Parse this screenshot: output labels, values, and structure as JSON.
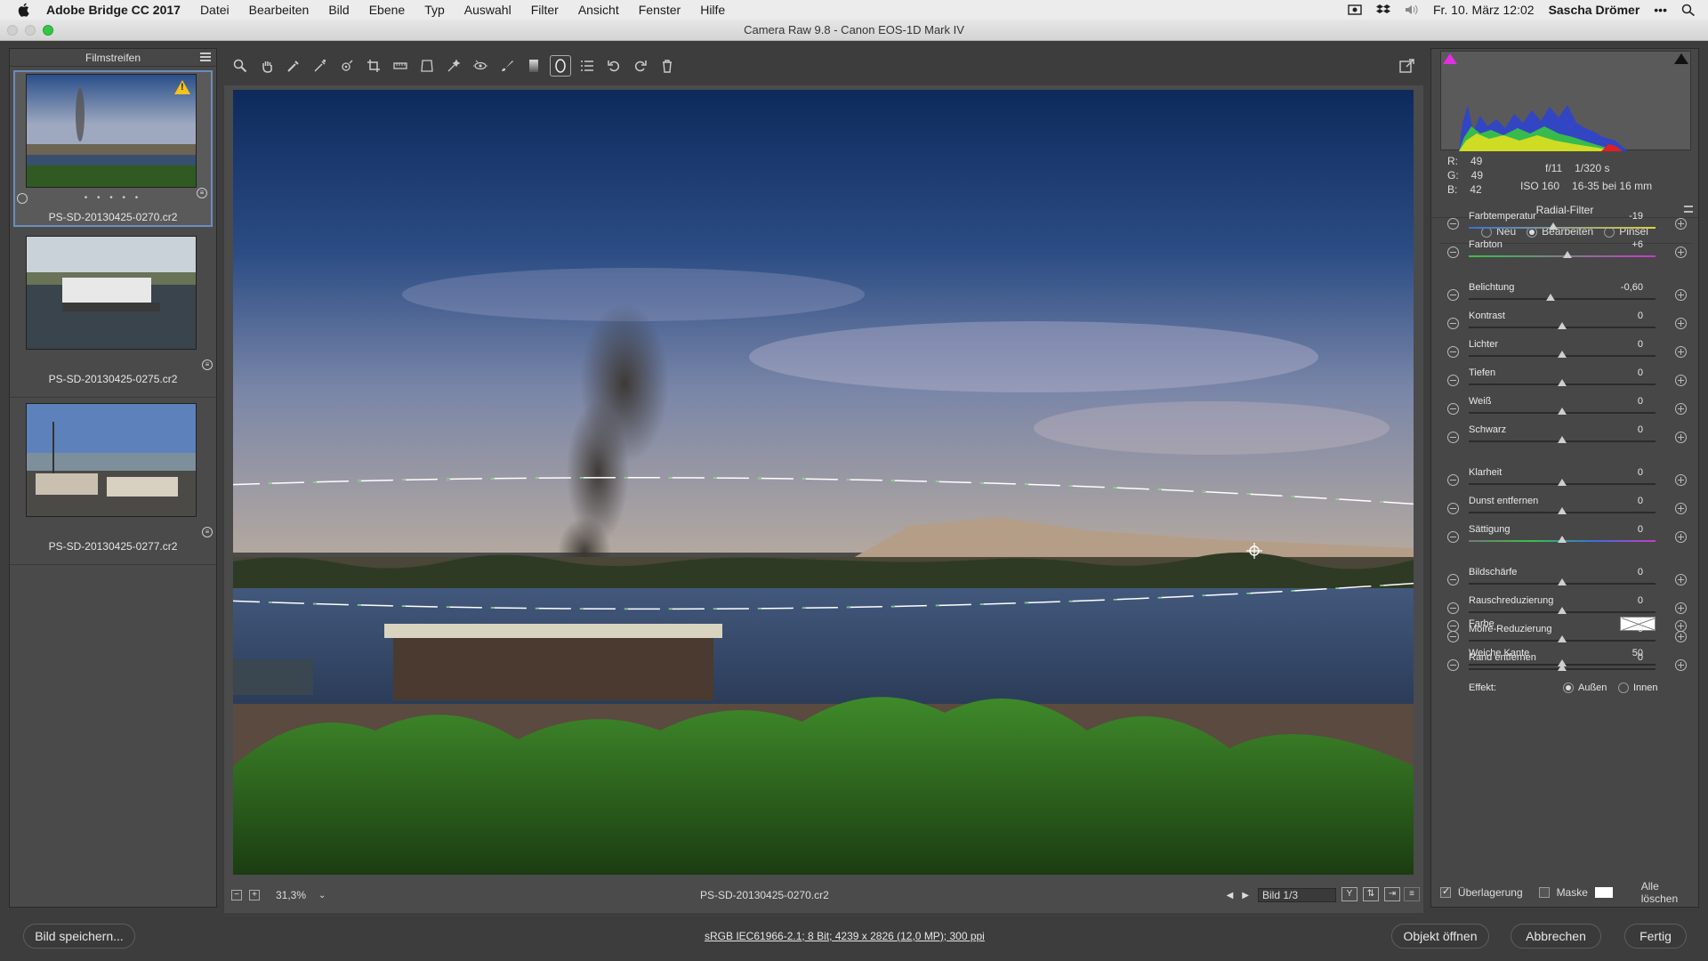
{
  "menubar": {
    "app_name": "Adobe Bridge CC 2017",
    "items": [
      "Datei",
      "Bearbeiten",
      "Bild",
      "Ebene",
      "Typ",
      "Auswahl",
      "Filter",
      "Ansicht",
      "Fenster",
      "Hilfe"
    ],
    "datetime": "Fr. 10. März 12:02",
    "user": "Sascha Drömer",
    "more": "•••"
  },
  "window": {
    "title": "Camera Raw 9.8 - Canon EOS-1D Mark IV"
  },
  "filmstrip": {
    "title": "Filmstreifen",
    "items": [
      {
        "name": "PS-SD-20130425-0270.cr2",
        "rating": "• • • • •"
      },
      {
        "name": "PS-SD-20130425-0275.cr2"
      },
      {
        "name": "PS-SD-20130425-0277.cr2"
      }
    ]
  },
  "status": {
    "zoom": "31,3%",
    "zoom_dropdown": "⌄",
    "filename": "PS-SD-20130425-0270.cr2",
    "image_counter": "Bild 1/3"
  },
  "histogram": {
    "r_label": "R:",
    "r": "49",
    "g_label": "G:",
    "g": "49",
    "b_label": "B:",
    "b": "42",
    "aperture": "f/11",
    "shutter": "1/320 s",
    "iso": "ISO 160",
    "lens": "16-35 bei 16 mm"
  },
  "panel": {
    "title": "Radial-Filter",
    "modes": [
      {
        "label": "Neu",
        "selected": false
      },
      {
        "label": "Bearbeiten",
        "selected": true
      },
      {
        "label": "Pinsel",
        "selected": false
      }
    ],
    "sliders": [
      {
        "label": "Farbtemperatur",
        "value": "-19",
        "pos": 0.45,
        "track": "temp"
      },
      {
        "label": "Farbton",
        "value": "+6",
        "pos": 0.53,
        "track": "tint"
      },
      {
        "label": "Belichtung",
        "value": "-0,60",
        "pos": 0.44,
        "track": "plain"
      },
      {
        "label": "Kontrast",
        "value": "0",
        "pos": 0.5,
        "track": "plain"
      },
      {
        "label": "Lichter",
        "value": "0",
        "pos": 0.5,
        "track": "plain"
      },
      {
        "label": "Tiefen",
        "value": "0",
        "pos": 0.5,
        "track": "plain"
      },
      {
        "label": "Weiß",
        "value": "0",
        "pos": 0.5,
        "track": "plain"
      },
      {
        "label": "Schwarz",
        "value": "0",
        "pos": 0.5,
        "track": "plain"
      },
      {
        "label": "Klarheit",
        "value": "0",
        "pos": 0.5,
        "track": "plain"
      },
      {
        "label": "Dunst entfernen",
        "value": "0",
        "pos": 0.5,
        "track": "plain"
      },
      {
        "label": "Sättigung",
        "value": "0",
        "pos": 0.5,
        "track": "sat"
      },
      {
        "label": "Bildschärfe",
        "value": "0",
        "pos": 0.5,
        "track": "plain"
      },
      {
        "label": "Rauschreduzierung",
        "value": "0",
        "pos": 0.5,
        "track": "plain"
      },
      {
        "label": "Moire-Reduzierung",
        "value": "0",
        "pos": 0.5,
        "track": "plain"
      },
      {
        "label": "Rand entfernen",
        "value": "0",
        "pos": 0.5,
        "track": "plain"
      }
    ],
    "farbe_label": "Farbe",
    "feather_label": "Weiche Kante",
    "feather_value": "50",
    "feather_pos": 0.5,
    "effect_label": "Effekt:",
    "effect_outside": "Außen",
    "effect_inside": "Innen",
    "overlay_label": "Überlagerung",
    "mask_label": "Maske",
    "clear_all": "Alle löschen"
  },
  "bottom": {
    "save": "Bild speichern...",
    "info": "sRGB IEC61966-2.1; 8 Bit; 4239 x 2826 (12,0 MP); 300 ppi",
    "open": "Objekt öffnen",
    "cancel": "Abbrechen",
    "done": "Fertig"
  }
}
